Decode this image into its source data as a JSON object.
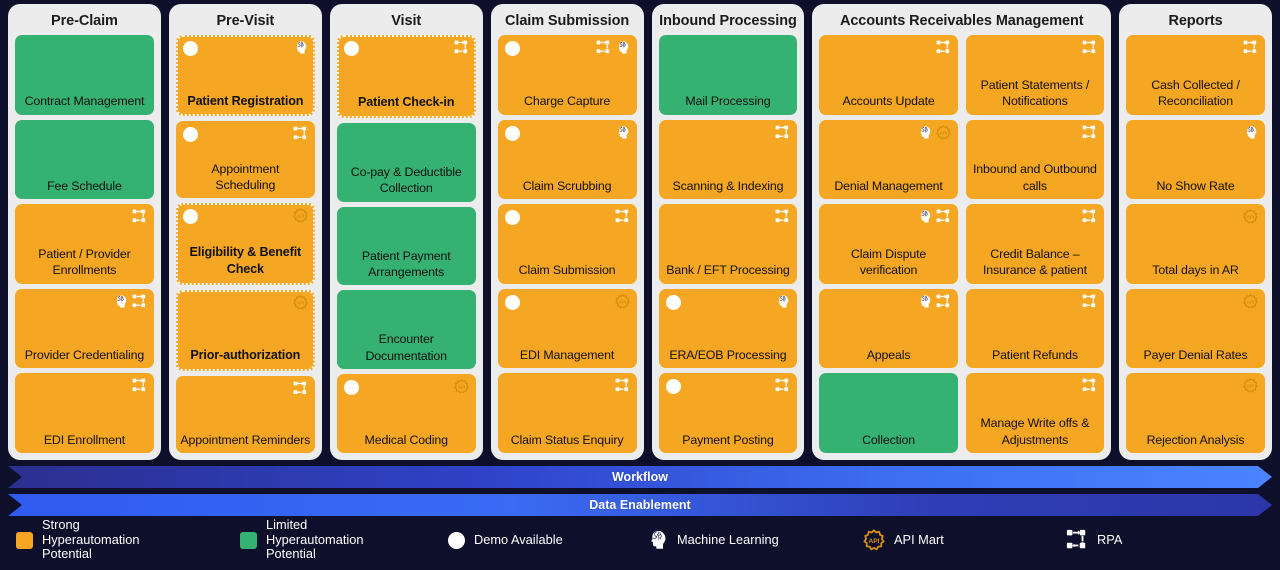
{
  "columns": [
    {
      "title": "Pre-Claim",
      "cards": [
        {
          "label": "Contract\nManagement",
          "color": "green",
          "dotted": false,
          "demo": false,
          "icons": []
        },
        {
          "label": "Fee Schedule",
          "color": "green",
          "dotted": false,
          "demo": false,
          "icons": []
        },
        {
          "label": "Patient / Provider\nEnrollments",
          "color": "orange",
          "dotted": false,
          "demo": false,
          "icons": [
            "rpa"
          ]
        },
        {
          "label": "Provider\nCredentialing",
          "color": "orange",
          "dotted": false,
          "demo": false,
          "icons": [
            "ml",
            "rpa"
          ]
        },
        {
          "label": "EDI Enrollment",
          "color": "orange",
          "dotted": false,
          "demo": false,
          "icons": [
            "rpa"
          ]
        }
      ]
    },
    {
      "title": "Pre-Visit",
      "cards": [
        {
          "label": "Patient\nRegistration",
          "color": "orange",
          "dotted": true,
          "demo": true,
          "icons": [
            "ml"
          ]
        },
        {
          "label": "Appointment\nScheduling",
          "color": "orange",
          "dotted": false,
          "demo": true,
          "icons": [
            "rpa"
          ]
        },
        {
          "label": "Eligibility &\nBenefit Check",
          "color": "orange",
          "dotted": true,
          "demo": true,
          "icons": [
            "api"
          ]
        },
        {
          "label": "Prior-authorization",
          "color": "orange",
          "dotted": true,
          "demo": false,
          "icons": [
            "api"
          ]
        },
        {
          "label": "Appointment\nReminders",
          "color": "orange",
          "dotted": false,
          "demo": false,
          "icons": [
            "rpa"
          ]
        }
      ]
    },
    {
      "title": "Visit",
      "cards": [
        {
          "label": "Patient\nCheck-in",
          "color": "orange",
          "dotted": true,
          "demo": true,
          "icons": [
            "rpa"
          ]
        },
        {
          "label": "Co-pay &\nDeductible\nCollection",
          "color": "green",
          "dotted": false,
          "demo": false,
          "icons": []
        },
        {
          "label": "Patient Payment\nArrangements",
          "color": "green",
          "dotted": false,
          "demo": false,
          "icons": []
        },
        {
          "label": "Encounter\nDocumentation",
          "color": "green",
          "dotted": false,
          "demo": false,
          "icons": []
        },
        {
          "label": "Medical Coding",
          "color": "orange",
          "dotted": false,
          "demo": true,
          "icons": [
            "api"
          ]
        }
      ]
    },
    {
      "title": "Claim Submission",
      "cards": [
        {
          "label": "Charge Capture",
          "color": "orange",
          "dotted": false,
          "demo": true,
          "icons": [
            "rpa",
            "ml"
          ]
        },
        {
          "label": "Claim Scrubbing",
          "color": "orange",
          "dotted": false,
          "demo": true,
          "icons": [
            "ml"
          ]
        },
        {
          "label": "Claim Submission",
          "color": "orange",
          "dotted": false,
          "demo": true,
          "icons": [
            "rpa"
          ]
        },
        {
          "label": "EDI Management",
          "color": "orange",
          "dotted": false,
          "demo": true,
          "icons": [
            "api"
          ]
        },
        {
          "label": "Claim Status\nEnquiry",
          "color": "orange",
          "dotted": false,
          "demo": false,
          "icons": [
            "rpa"
          ]
        }
      ]
    },
    {
      "title": "Inbound Processing",
      "cards": [
        {
          "label": "Mail Processing",
          "color": "green",
          "dotted": false,
          "demo": false,
          "icons": []
        },
        {
          "label": "Scanning &\nIndexing",
          "color": "orange",
          "dotted": false,
          "demo": false,
          "icons": [
            "rpa"
          ]
        },
        {
          "label": "Bank /\nEFT Processing",
          "color": "orange",
          "dotted": false,
          "demo": false,
          "icons": [
            "rpa"
          ]
        },
        {
          "label": "ERA/EOB\nProcessing",
          "color": "orange",
          "dotted": false,
          "demo": true,
          "icons": [
            "ml"
          ]
        },
        {
          "label": "Payment\nPosting",
          "color": "orange",
          "dotted": false,
          "demo": true,
          "icons": [
            "rpa"
          ]
        }
      ]
    },
    {
      "title": "Accounts Receivables Management",
      "wide": true,
      "subcolumns": [
        {
          "cards": [
            {
              "label": "Accounts Update",
              "color": "orange",
              "dotted": false,
              "demo": false,
              "icons": [
                "rpa"
              ]
            },
            {
              "label": "Denial\nManagement",
              "color": "orange",
              "dotted": false,
              "demo": false,
              "icons": [
                "ml",
                "api"
              ]
            },
            {
              "label": "Claim Dispute\nverification",
              "color": "orange",
              "dotted": false,
              "demo": false,
              "icons": [
                "ml",
                "rpa"
              ]
            },
            {
              "label": "Appeals",
              "color": "orange",
              "dotted": false,
              "demo": false,
              "icons": [
                "ml",
                "rpa"
              ]
            },
            {
              "label": "Collection",
              "color": "green",
              "dotted": false,
              "demo": false,
              "icons": []
            }
          ]
        },
        {
          "cards": [
            {
              "label": "Patient Statements\n/ Notifications",
              "color": "orange",
              "dotted": false,
              "demo": false,
              "icons": [
                "rpa"
              ]
            },
            {
              "label": "Inbound and\nOutbound calls",
              "color": "orange",
              "dotted": false,
              "demo": false,
              "icons": [
                "rpa"
              ]
            },
            {
              "label": "Credit Balance –\nInsurance & patient",
              "color": "orange",
              "dotted": false,
              "demo": false,
              "icons": [
                "rpa"
              ]
            },
            {
              "label": "Patient Refunds",
              "color": "orange",
              "dotted": false,
              "demo": false,
              "icons": [
                "rpa"
              ]
            },
            {
              "label": "Manage Write offs\n& Adjustments",
              "color": "orange",
              "dotted": false,
              "demo": false,
              "icons": [
                "rpa"
              ]
            }
          ]
        }
      ]
    },
    {
      "title": "Reports",
      "cards": [
        {
          "label": "Cash Collected /\nReconciliation",
          "color": "orange",
          "dotted": false,
          "demo": false,
          "icons": [
            "rpa"
          ]
        },
        {
          "label": "No Show Rate",
          "color": "orange",
          "dotted": false,
          "demo": false,
          "icons": [
            "ml"
          ]
        },
        {
          "label": "Total days in AR",
          "color": "orange",
          "dotted": false,
          "demo": false,
          "icons": [
            "api"
          ]
        },
        {
          "label": "Payer Denial Rates",
          "color": "orange",
          "dotted": false,
          "demo": false,
          "icons": [
            "api"
          ]
        },
        {
          "label": "Rejection Analysis",
          "color": "orange",
          "dotted": false,
          "demo": false,
          "icons": [
            "api"
          ]
        }
      ]
    }
  ],
  "bars": [
    {
      "label": "Workflow",
      "style": "workflow"
    },
    {
      "label": "Data Enablement",
      "style": "data"
    }
  ],
  "legend": [
    {
      "kind": "swatch-orange",
      "label": "Strong\nHyperautomation\nPotential",
      "icon": "orange-square-icon"
    },
    {
      "kind": "swatch-green",
      "label": "Limited\nHyperautomation\nPotential",
      "icon": "green-square-icon"
    },
    {
      "kind": "dot",
      "label": "Demo Available",
      "icon": "white-circle-icon"
    },
    {
      "kind": "ml",
      "label": "Machine Learning",
      "icon": "brain-head-icon"
    },
    {
      "kind": "api",
      "label": "API Mart",
      "icon": "api-badge-icon"
    },
    {
      "kind": "rpa",
      "label": "RPA",
      "icon": "rpa-flow-icon"
    }
  ],
  "colors": {
    "background": "#0d0f2b",
    "panel": "#ececed",
    "strong": "#f5a623",
    "limited": "#35b171",
    "api": "#e09b0e"
  }
}
